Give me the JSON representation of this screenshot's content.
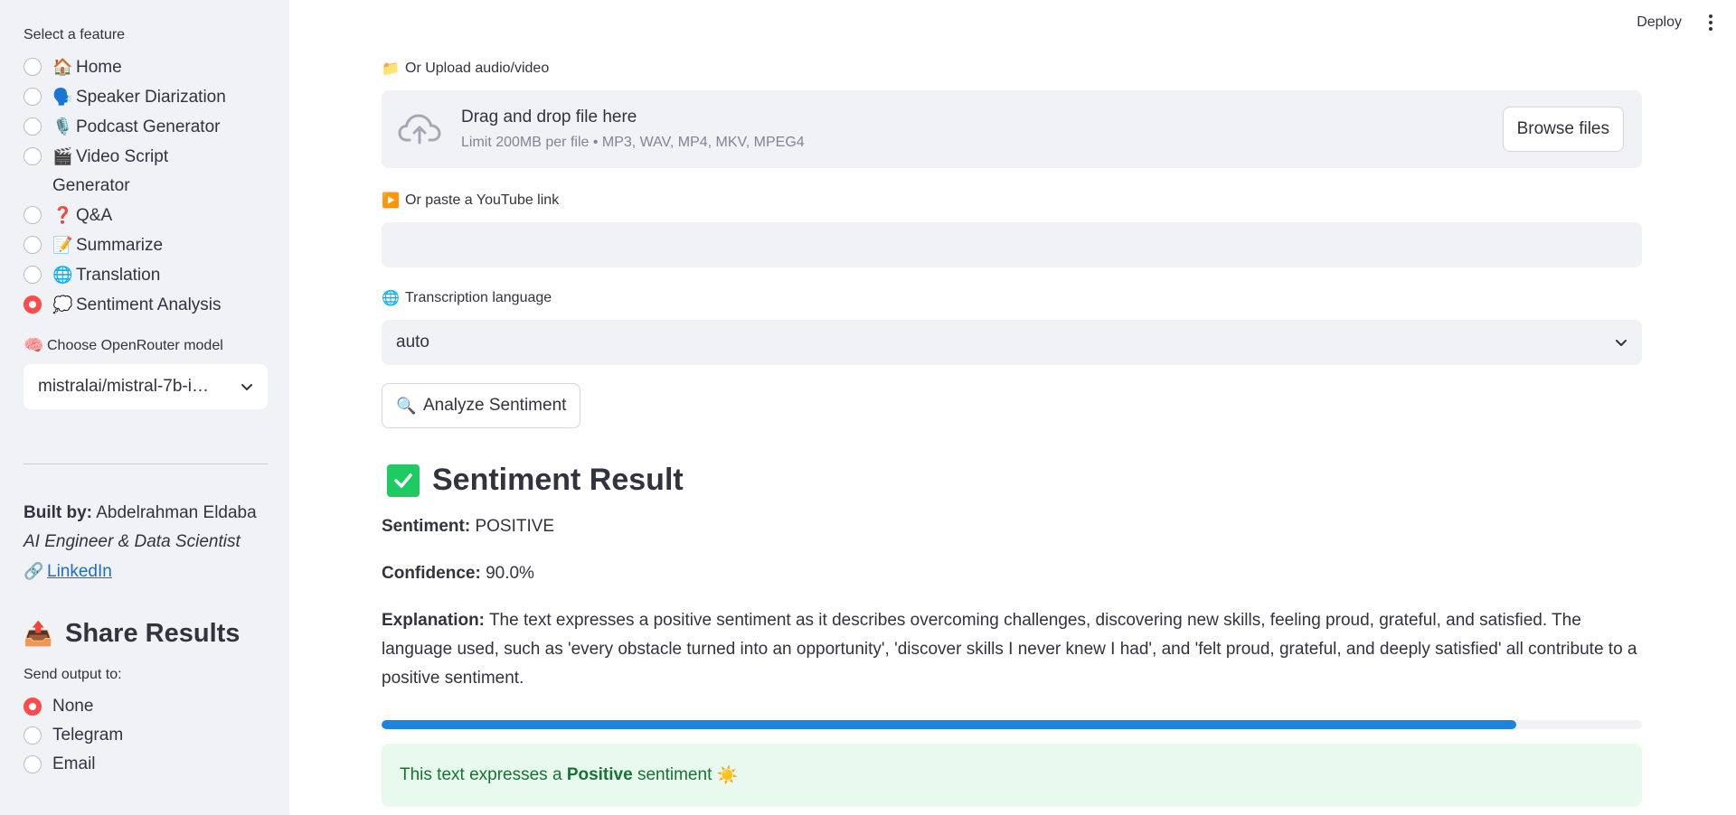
{
  "sidebar": {
    "feature_label": "Select a feature",
    "features": [
      {
        "emoji": "🏠",
        "label": "Home",
        "checked": false
      },
      {
        "emoji": "🗣️",
        "label": "Speaker Diarization",
        "checked": false
      },
      {
        "emoji": "🎙️",
        "label": "Podcast Generator",
        "checked": false
      },
      {
        "emoji": "🎬",
        "label": "Video Script Generator",
        "checked": false
      },
      {
        "emoji": "❓",
        "label": "Q&A",
        "checked": false
      },
      {
        "emoji": "📝",
        "label": "Summarize",
        "checked": false
      },
      {
        "emoji": "🌐",
        "label": "Translation",
        "checked": false
      },
      {
        "emoji": "💭",
        "label": "Sentiment Analysis",
        "checked": true
      }
    ],
    "model_emoji": "🧠",
    "model_label": "Choose OpenRouter model",
    "model_value": "mistralai/mistral-7b-i…",
    "built_by_label": "Built by:",
    "built_by_name": "Abdelrahman Eldaba",
    "role": "AI Engineer & Data Scientist",
    "link_emoji": "🔗",
    "link_text": "LinkedIn",
    "share_emoji": "📤",
    "share_title": "Share Results",
    "send_label": "Send output to:",
    "send_options": [
      {
        "label": "None",
        "checked": true
      },
      {
        "label": "Telegram",
        "checked": false
      },
      {
        "label": "Email",
        "checked": false
      }
    ]
  },
  "topbar": {
    "deploy_label": "Deploy"
  },
  "main": {
    "upload_emoji": "📁",
    "upload_label": "Or Upload audio/video",
    "upload_drop_text": "Drag and drop file here",
    "upload_limit_text": "Limit 200MB per file • MP3, WAV, MP4, MKV, MPEG4",
    "browse_label": "Browse files",
    "youtube_emoji": "▶️",
    "youtube_label": "Or paste a YouTube link",
    "youtube_value": "",
    "lang_emoji": "🌐",
    "lang_label": "Transcription language",
    "lang_value": "auto",
    "analyze_emoji": "🔍",
    "analyze_label": "Analyze Sentiment",
    "result_title": "Sentiment Result",
    "sentiment_label": "Sentiment:",
    "sentiment_value": "POSITIVE",
    "confidence_label": "Confidence:",
    "confidence_value": "90.0%",
    "explanation_label": "Explanation:",
    "explanation_text": "The text expresses a positive sentiment as it describes overcoming challenges, discovering new skills, feeling proud, grateful, and satisfied. The language used, such as 'every obstacle turned into an opportunity', 'discover skills I never knew I had', and 'felt proud, grateful, and deeply satisfied' all contribute to a positive sentiment.",
    "progress_fraction": 0.9,
    "success_prefix": "This text expresses a",
    "success_bold": "Positive",
    "success_suffix": "sentiment",
    "success_emoji": "☀️"
  },
  "colors": {
    "accent": "#ff4b4b",
    "progress": "#1c83e1",
    "success_bg": "#e8f9ee",
    "success_text": "#177233",
    "check_green": "#1fca63"
  },
  "icons": [
    "cloud-upload-icon",
    "chevron-down-icon",
    "kebab-menu-icon",
    "check-mark-icon"
  ]
}
